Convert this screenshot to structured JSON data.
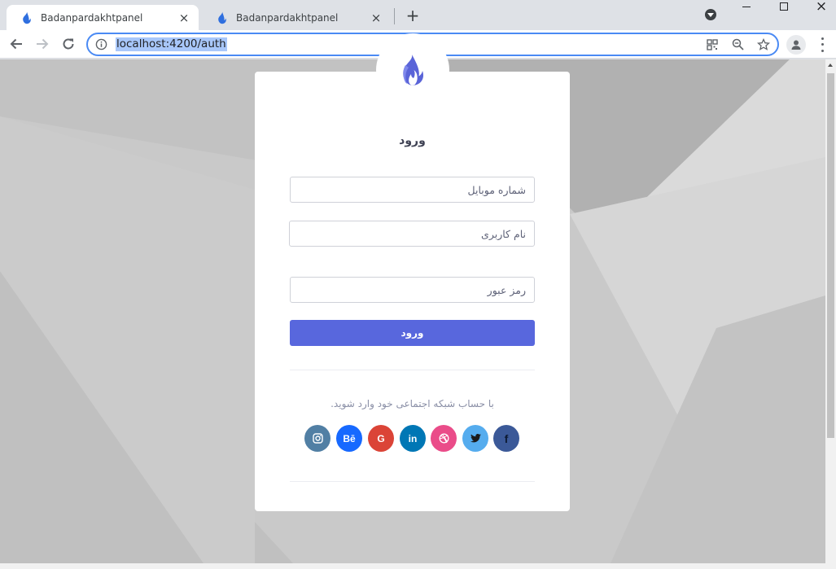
{
  "browser": {
    "tabs": [
      {
        "title": "Badanpardakhtpanel",
        "active": true
      },
      {
        "title": "Badanpardakhtpanel",
        "active": false
      }
    ],
    "new_tab_label": "+",
    "close_glyph": "×",
    "url": "localhost:4200/auth",
    "accent_color": "#4a8af4"
  },
  "login": {
    "title": "ورود",
    "mobile_placeholder": "شماره موبایل",
    "username_placeholder": "نام کاربری",
    "password_placeholder": "رمز عبور",
    "submit_label": "ورود",
    "social_text": "با حساب شبکه اجتماعی خود وارد شوید.",
    "button_color": "#5867dd",
    "social": [
      {
        "name": "instagram",
        "glyph": "",
        "color": "#517fa4"
      },
      {
        "name": "behance",
        "glyph": "Bē",
        "color": "#1769ff"
      },
      {
        "name": "google",
        "glyph": "G",
        "color": "#db4437"
      },
      {
        "name": "linkedin",
        "glyph": "in",
        "color": "#0077b5"
      },
      {
        "name": "dribbble",
        "glyph": "",
        "color": "#ea4c89"
      },
      {
        "name": "twitter",
        "glyph": "",
        "color": "#55acee"
      },
      {
        "name": "facebook",
        "glyph": "f",
        "color": "#3b5998"
      }
    ]
  }
}
